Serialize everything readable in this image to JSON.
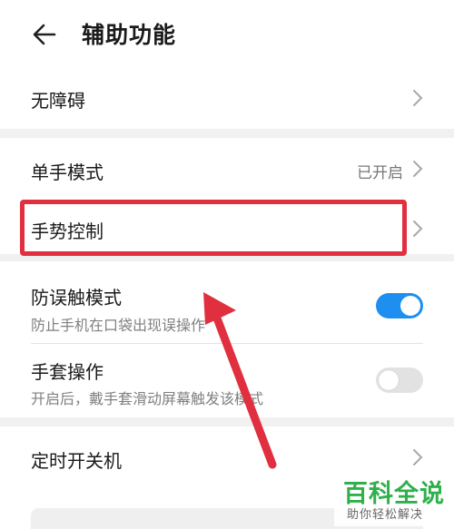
{
  "header": {
    "title": "辅助功能"
  },
  "rows": {
    "accessibility": {
      "label": "无障碍"
    },
    "one_hand": {
      "label": "单手模式",
      "value": "已开启"
    },
    "gesture": {
      "label": "手势控制"
    },
    "mistouch": {
      "label": "防误触模式",
      "subtitle": "防止手机在口袋出现误操作",
      "enabled": true
    },
    "glove": {
      "label": "手套操作",
      "subtitle": "开启后，戴手套滑动屏幕触发该模式",
      "enabled": false
    },
    "timer_power": {
      "label": "定时开关机"
    }
  },
  "annotation": {
    "highlight_color": "#e0303f",
    "arrow_color": "#e0303f"
  },
  "colors": {
    "toggle_on": "#1e8ff0",
    "toggle_off": "#e2e2e2"
  },
  "watermark": {
    "title": "百科全说",
    "subtitle": "助你轻松解决"
  }
}
